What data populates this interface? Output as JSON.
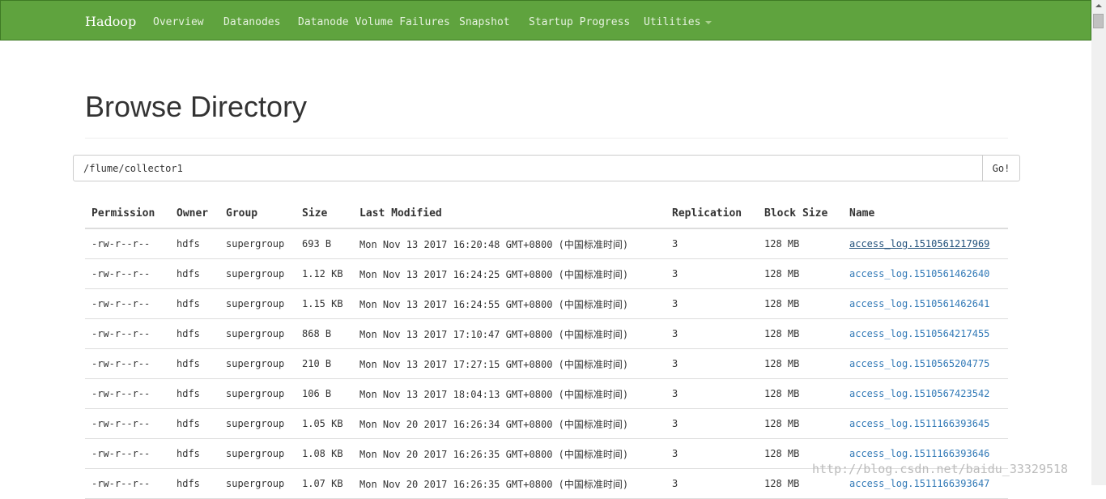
{
  "navbar": {
    "brand": "Hadoop",
    "items": [
      {
        "label": "Overview"
      },
      {
        "label": "Datanodes"
      },
      {
        "label": "Datanode Volume Failures"
      },
      {
        "label": "Snapshot"
      },
      {
        "label": "Startup Progress"
      },
      {
        "label": "Utilities"
      }
    ]
  },
  "page": {
    "title": "Browse Directory",
    "path_value": "/flume/collector1",
    "go_label": "Go!"
  },
  "table": {
    "headers": [
      "Permission",
      "Owner",
      "Group",
      "Size",
      "Last Modified",
      "Replication",
      "Block Size",
      "Name"
    ],
    "rows": [
      {
        "permission": "-rw-r--r--",
        "owner": "hdfs",
        "group": "supergroup",
        "size": "693 B",
        "modified": "Mon Nov 13 2017 16:20:48 GMT+0800 (中国标准时间)",
        "replication": "3",
        "block_size": "128 MB",
        "name": "access_log.1510561217969"
      },
      {
        "permission": "-rw-r--r--",
        "owner": "hdfs",
        "group": "supergroup",
        "size": "1.12 KB",
        "modified": "Mon Nov 13 2017 16:24:25 GMT+0800 (中国标准时间)",
        "replication": "3",
        "block_size": "128 MB",
        "name": "access_log.1510561462640"
      },
      {
        "permission": "-rw-r--r--",
        "owner": "hdfs",
        "group": "supergroup",
        "size": "1.15 KB",
        "modified": "Mon Nov 13 2017 16:24:55 GMT+0800 (中国标准时间)",
        "replication": "3",
        "block_size": "128 MB",
        "name": "access_log.1510561462641"
      },
      {
        "permission": "-rw-r--r--",
        "owner": "hdfs",
        "group": "supergroup",
        "size": "868 B",
        "modified": "Mon Nov 13 2017 17:10:47 GMT+0800 (中国标准时间)",
        "replication": "3",
        "block_size": "128 MB",
        "name": "access_log.1510564217455"
      },
      {
        "permission": "-rw-r--r--",
        "owner": "hdfs",
        "group": "supergroup",
        "size": "210 B",
        "modified": "Mon Nov 13 2017 17:27:15 GMT+0800 (中国标准时间)",
        "replication": "3",
        "block_size": "128 MB",
        "name": "access_log.1510565204775"
      },
      {
        "permission": "-rw-r--r--",
        "owner": "hdfs",
        "group": "supergroup",
        "size": "106 B",
        "modified": "Mon Nov 13 2017 18:04:13 GMT+0800 (中国标准时间)",
        "replication": "3",
        "block_size": "128 MB",
        "name": "access_log.1510567423542"
      },
      {
        "permission": "-rw-r--r--",
        "owner": "hdfs",
        "group": "supergroup",
        "size": "1.05 KB",
        "modified": "Mon Nov 20 2017 16:26:34 GMT+0800 (中国标准时间)",
        "replication": "3",
        "block_size": "128 MB",
        "name": "access_log.1511166393645"
      },
      {
        "permission": "-rw-r--r--",
        "owner": "hdfs",
        "group": "supergroup",
        "size": "1.08 KB",
        "modified": "Mon Nov 20 2017 16:26:35 GMT+0800 (中国标准时间)",
        "replication": "3",
        "block_size": "128 MB",
        "name": "access_log.1511166393646"
      },
      {
        "permission": "-rw-r--r--",
        "owner": "hdfs",
        "group": "supergroup",
        "size": "1.07 KB",
        "modified": "Mon Nov 20 2017 16:26:35 GMT+0800 (中国标准时间)",
        "replication": "3",
        "block_size": "128 MB",
        "name": "access_log.1511166393647"
      }
    ]
  },
  "watermark": "http://blog.csdn.net/baidu_33329518",
  "colors": {
    "navbar": "#5fa33e",
    "link": "#337ab7"
  }
}
